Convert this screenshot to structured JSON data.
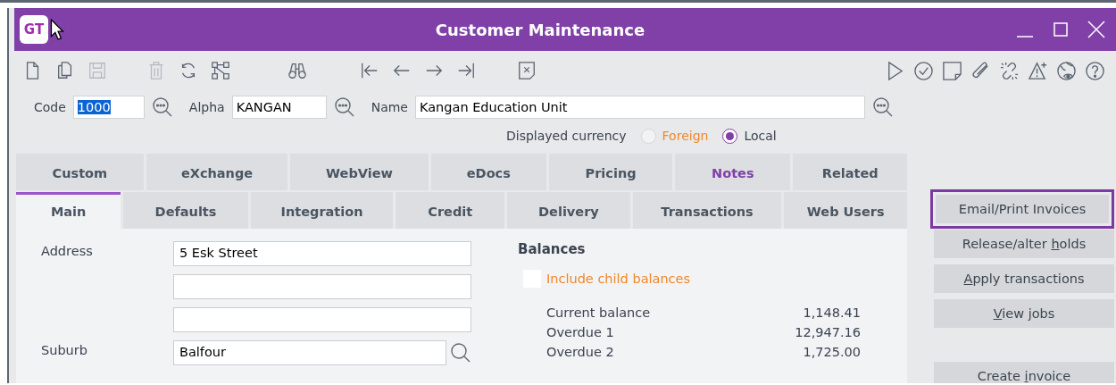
{
  "window": {
    "title": "Customer Maintenance",
    "logo": "GT"
  },
  "toolbar": {
    "left": [
      {
        "disabled": false
      },
      {
        "disabled": false
      },
      {
        "disabled": true
      },
      {
        "disabled": true
      },
      {
        "disabled": false
      },
      {
        "disabled": false
      },
      {
        "disabled": false
      },
      {
        "disabled": false
      },
      {
        "disabled": false
      },
      {
        "disabled": false
      },
      {
        "disabled": false
      },
      {
        "disabled": false
      }
    ],
    "right": [
      {
        "disabled": false
      },
      {
        "disabled": false
      },
      {
        "disabled": false
      },
      {
        "disabled": false
      },
      {
        "disabled": false
      },
      {
        "disabled": false
      },
      {
        "disabled": false
      },
      {
        "disabled": false
      }
    ]
  },
  "lookup": [
    {
      "label": "Code",
      "value": "1000",
      "text_selected": true
    },
    {
      "label": "Alpha",
      "value": "KANGAN",
      "text_selected": false
    },
    {
      "label": "Name",
      "value": "Kangan Education Unit",
      "text_selected": false
    }
  ],
  "currency": {
    "label": "Displayed currency",
    "options": [
      {
        "label": "Foreign",
        "selected": false
      },
      {
        "label": "Local",
        "selected": true
      }
    ]
  },
  "tabs": [
    [
      {
        "label": "Custom",
        "selected": false,
        "has_content": false
      },
      {
        "label": "eXchange",
        "selected": false,
        "has_content": false
      },
      {
        "label": "WebView",
        "selected": false,
        "has_content": false
      },
      {
        "label": "eDocs",
        "selected": false,
        "has_content": false
      },
      {
        "label": "Pricing",
        "selected": false,
        "has_content": false
      },
      {
        "label": "Notes",
        "selected": false,
        "has_content": true
      },
      {
        "label": "Related",
        "selected": false,
        "has_content": false
      }
    ],
    [
      {
        "label": "Main",
        "selected": true,
        "has_content": false
      },
      {
        "label": "Defaults",
        "selected": false,
        "has_content": false
      },
      {
        "label": "Integration",
        "selected": false,
        "has_content": false
      },
      {
        "label": "Credit",
        "selected": false,
        "has_content": false
      },
      {
        "label": "Delivery",
        "selected": false,
        "has_content": false
      },
      {
        "label": "Transactions",
        "selected": false,
        "has_content": false
      },
      {
        "label": "Web Users",
        "selected": false,
        "has_content": false
      }
    ]
  ],
  "side_buttons": [
    [
      {
        "label": "Email/Print Invoices",
        "highlighted": true
      },
      {
        "label_parts": [
          {
            "text": "Release/alter ",
            "underlined": false
          },
          {
            "text": "h",
            "underlined": true
          },
          {
            "text": "olds",
            "underlined": false
          }
        ],
        "highlighted": false
      },
      {
        "label_parts": [
          {
            "text": "A",
            "underlined": true
          },
          {
            "text": "pply transactions",
            "underlined": false
          }
        ],
        "highlighted": false
      },
      {
        "label_parts": [
          {
            "text": "V",
            "underlined": true
          },
          {
            "text": "iew jobs",
            "underlined": false
          }
        ],
        "highlighted": false
      }
    ],
    [
      {
        "label_parts": [
          {
            "text": "Create ",
            "underlined": false
          },
          {
            "text": "i",
            "underlined": true
          },
          {
            "text": "nvoice",
            "underlined": false
          }
        ],
        "highlighted": false
      }
    ]
  ],
  "main": {
    "address": {
      "label": "Address",
      "value": "5 Esk Street"
    },
    "suburb": {
      "label": "Suburb",
      "value": "Balfour"
    },
    "balances": {
      "title": "Balances",
      "include_child": {
        "label": "Include child balances",
        "checked": false
      },
      "rows": [
        {
          "label": "Current balance",
          "value": "1,148.41"
        },
        {
          "label": "Overdue 1",
          "value": "12,947.16"
        },
        {
          "label": "Overdue 2",
          "value": "1,725.00"
        }
      ]
    }
  }
}
